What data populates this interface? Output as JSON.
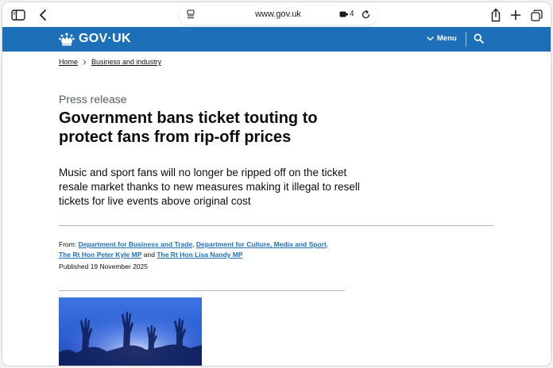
{
  "browser": {
    "url": "www.gov.uk",
    "extensions_count": "4"
  },
  "header": {
    "logo_text": "GOV·UK",
    "menu_label": "Menu"
  },
  "breadcrumb": {
    "items": [
      "Home",
      "Business and industry"
    ]
  },
  "article": {
    "caption": "Press release",
    "title": "Government bans ticket touting to protect fans from rip-off prices",
    "lede": "Music and sport fans will no longer be ripped off on the ticket resale market thanks to new measures making it illegal to resell tickets for live events above original cost",
    "from_label": "From:",
    "orgs": [
      "Department for Business and Trade",
      "Department for Culture, Media and Sport",
      "The Rt Hon Peter Kyle MP",
      "The Rt Hon Lisa Nandy MP"
    ],
    "sep_comma": ",",
    "and_word": "and",
    "published": "Published 19 November 2025"
  },
  "colors": {
    "govuk_blue": "#1d70b8",
    "text": "#0b0c0c",
    "caption": "#505a5f"
  }
}
